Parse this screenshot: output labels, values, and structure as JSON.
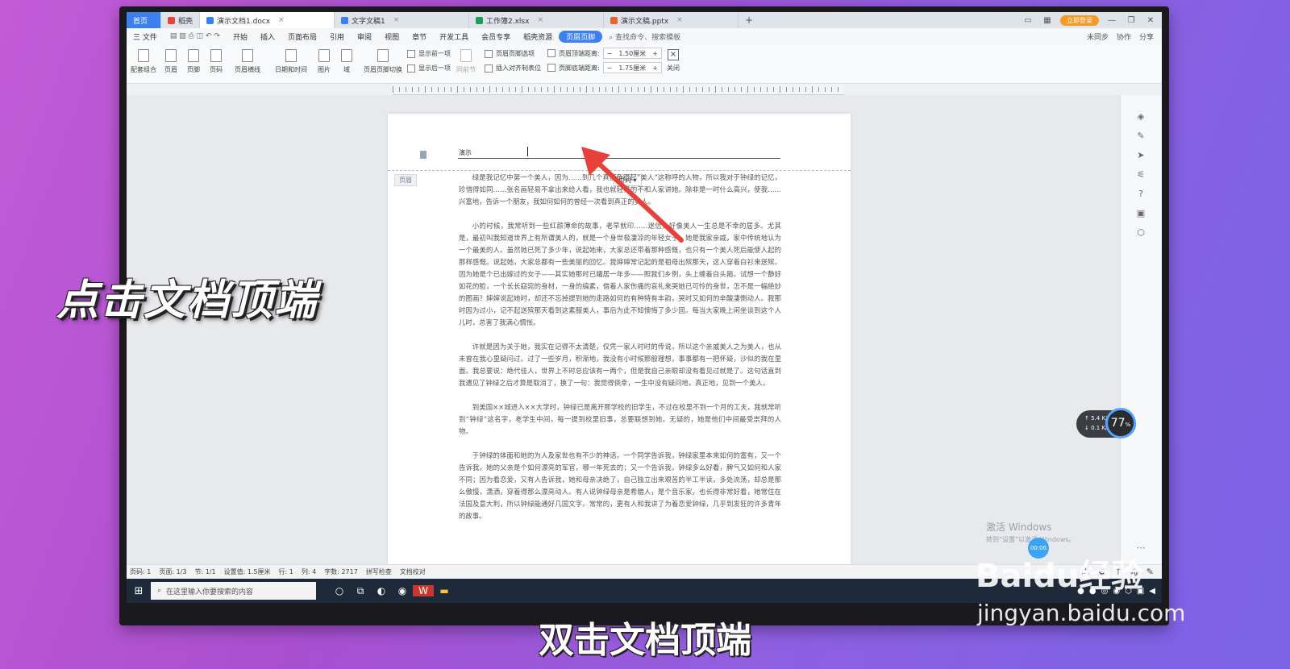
{
  "tabs": [
    {
      "label": "首页"
    },
    {
      "label": "稻壳"
    },
    {
      "label": "演示文档1.docx"
    },
    {
      "label": "文字文稿1"
    },
    {
      "label": "工作簿2.xlsx"
    },
    {
      "label": "演示文稿.pptx"
    }
  ],
  "login_label": "立即登录",
  "menu": [
    "三 文件",
    "开始",
    "插入",
    "页面布局",
    "引用",
    "审阅",
    "视图",
    "章节",
    "开发工具",
    "会员专享",
    "稻壳资源",
    "页眉页脚"
  ],
  "search_label": "查找命令、搜索模板",
  "menu_right": [
    "未同步",
    "协作",
    "分享"
  ],
  "ribbon": {
    "btns": [
      "配套组合",
      "页眉",
      "页脚",
      "页码",
      "页眉横线",
      "日期和时间",
      "图片",
      "域",
      "页眉页脚切换"
    ],
    "show_prev": "显示前一项",
    "show_next": "显示后一项",
    "same_prev": "同前节",
    "options": "页眉页脚选项",
    "insert_tab": "插入对齐制表位",
    "top_dist_label": "页眉顶端距离:",
    "top_dist_value": "1.50厘米",
    "bottom_dist_label": "页脚底端距离:",
    "bottom_dist_value": "1.75厘米",
    "close": "关闭"
  },
  "doc": {
    "header_text": "演示",
    "header_label": "页眉",
    "pagenum_btn": "页码",
    "paragraphs": [
      "绿是我记忆中第一个美人，因为……到几个真正负得起“美人”这称呼的人物，所以我对于钟绿的记忆，珍惜得如同……张名画轻易不拿出来给人看，我也就轻易的不和人家讲她。除非是一时什么高兴，使我……兴富地，告诉一个朋友，我如何如何的曾经一次看到真正的美人。",
      "小的时候，我常听到一些红颜薄命的故事，老早就印……迷信，好像美人一生总是不幸的居多。尤其是，最初叫我知道世界上有所谓美人的，就是一个身世极凄凉的年轻女子。她是我家亲戚，家中传统地认为一个最美的人。虽然她已死了多少年，说起她来，大家总还带着那种感慨，也只有一个美人死后能使人起的那样感慨。说起她，大家总都有一些美丽的回忆。我婶婶常记起的是祖母出殡那天，这人穿着白衫来送殡。因为她是个已出嫁过的女子——其实她那时已孀居一年多——照我们乡例，头上缠着白头箍。试想一个静好如花的脸，一个长长窈窕的身材，一身的缟素，借着人家伤痛的哀礼来哭她已可怜的身世，怎不是一幅绝妙的图画？婶婶说起她时，却还不忘掉提到她的走路如何的有种特有丰韵，哭时又如何的辛酸凄惻动人。我那时因为过小，记不起送殡那天看到这素服美人，事后为此不知懊悔了多少回。每当大家晚上闲坐谈到这个人儿时，总害了我满心惆怅。",
      "许就是因为关于她，我实在记得不太清楚，仅凭一家人时时的传说，所以这个亲戚美人之为美人，也从未曾在我心里疑问过。过了一些岁月，积渐地，我没有小时候那般理想，事事都有一把怀疑，沙似的我在里面。我总要说：绝代佳人，世界上不时总应该有一两个，但是我自己亲眼却没有看见过就是了。这句话直到我遇见了钟绿之后才算是取消了，换了一句：我觉得侥幸，一生中没有疑问地，真正地，见到一个美人。",
      "到美国××城进入××大学时，钟绿已是离开那学校的旧学生，不过在校里不到一个月的工夫，我就常听到“钟绿”这名字，老学生中间，每一提到校里旧事，总要联想到她。无疑的，她是他们中间最受崇拜的人物。",
      "于钟绿的体面和她的为人及家世也有不少的神话。一个同学告诉我，钟绿家里本来如何的富有，又一个告诉我，她的父亲是个如何漂亮的军官，哪一年死去的；又一个告诉我，钟绿多么好看，脾气又如何和人家不同；因为看恋爱，又有人告诉我，她和母亲决绝了，自己独立出来艰苦的半工半读，多处流荡，却总是那么傲慢，潇洒，穿着得那么漂亮动人。有人说钟绿母亲是希腊人，是个音乐家，也长得非常好看，她常住在法国及意大利，所以钟绿能通好几国文字。常常的，更有人和我讲了为着恋爱钟绿，几乎到发狂的许多青年的故事。"
    ]
  },
  "speed": {
    "up": "5.4",
    "down": "0.1",
    "percent": "77"
  },
  "windows_watermark": {
    "line1": "激活 Windows",
    "line2": "转到“设置”以激活 Windows。"
  },
  "timer": "00:06",
  "status": [
    "页码: 1",
    "页面: 1/3",
    "节: 1/1",
    "设置值: 1.5厘米",
    "行: 1",
    "列: 4",
    "字数: 2717",
    "拼写检查",
    "文档校对"
  ],
  "taskbar": {
    "search_placeholder": "在这里输入你要搜索的内容"
  },
  "overlay": {
    "big_caption": "点击文档顶端",
    "subtitle": "双击文档顶端",
    "baidu": "Baidu经验",
    "baidu_url": "jingyan.baidu.com"
  },
  "colors": {
    "accent": "#3b7ff0",
    "arrow": "#e8413a",
    "login": "#f59a23"
  }
}
